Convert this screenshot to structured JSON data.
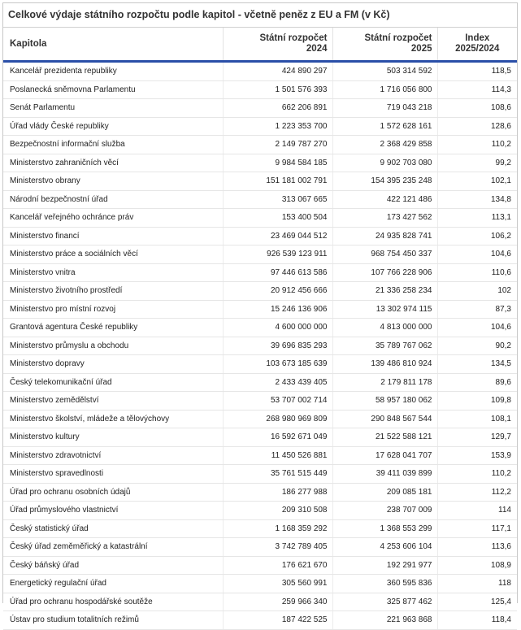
{
  "title": "Celkové výdaje státního rozpočtu podle kapitol - včetně peněz z EU a FM (v Kč)",
  "columns": {
    "kapitola": "Kapitola",
    "rozpocet_2024": [
      "Státní rozpočet",
      "2024"
    ],
    "rozpocet_2025": [
      "Státní rozpočet",
      "2025"
    ],
    "index": [
      "Index",
      "2025/2024"
    ]
  },
  "rows": [
    {
      "name": "Kancelář prezidenta republiky",
      "r2024": "424 890 297",
      "r2025": "503 314 592",
      "index": "118,5"
    },
    {
      "name": "Poslanecká sněmovna Parlamentu",
      "r2024": "1 501 576 393",
      "r2025": "1 716 056 800",
      "index": "114,3"
    },
    {
      "name": "Senát Parlamentu",
      "r2024": "662 206 891",
      "r2025": "719 043 218",
      "index": "108,6"
    },
    {
      "name": "Úřad vlády České republiky",
      "r2024": "1 223 353 700",
      "r2025": "1 572 628 161",
      "index": "128,6"
    },
    {
      "name": "Bezpečnostní informační služba",
      "r2024": "2 149 787 270",
      "r2025": "2 368 429 858",
      "index": "110,2"
    },
    {
      "name": "Ministerstvo zahraničních věcí",
      "r2024": "9 984 584 185",
      "r2025": "9 902 703 080",
      "index": "99,2"
    },
    {
      "name": "Ministerstvo obrany",
      "r2024": "151 181 002 791",
      "r2025": "154 395 235 248",
      "index": "102,1"
    },
    {
      "name": "Národní bezpečnostní úřad",
      "r2024": "313 067 665",
      "r2025": "422 121 486",
      "index": "134,8"
    },
    {
      "name": "Kancelář veřejného ochránce práv",
      "r2024": "153 400 504",
      "r2025": "173 427 562",
      "index": "113,1"
    },
    {
      "name": "Ministerstvo financí",
      "r2024": "23 469 044 512",
      "r2025": "24 935 828 741",
      "index": "106,2"
    },
    {
      "name": "Ministerstvo práce a sociálních věcí",
      "r2024": "926 539 123 911",
      "r2025": "968 754 450 337",
      "index": "104,6"
    },
    {
      "name": "Ministerstvo vnitra",
      "r2024": "97 446 613 586",
      "r2025": "107 766 228 906",
      "index": "110,6"
    },
    {
      "name": "Ministerstvo životního prostředí",
      "r2024": "20 912 456 666",
      "r2025": "21 336 258 234",
      "index": "102"
    },
    {
      "name": "Ministerstvo pro místní rozvoj",
      "r2024": "15 246 136 906",
      "r2025": "13 302 974 115",
      "index": "87,3"
    },
    {
      "name": "Grantová agentura České republiky",
      "r2024": "4 600 000 000",
      "r2025": "4 813 000 000",
      "index": "104,6"
    },
    {
      "name": "Ministerstvo průmyslu a obchodu",
      "r2024": "39 696 835 293",
      "r2025": "35 789 767 062",
      "index": "90,2"
    },
    {
      "name": "Ministerstvo dopravy",
      "r2024": "103 673 185 639",
      "r2025": "139 486 810 924",
      "index": "134,5"
    },
    {
      "name": "Český telekomunikační úřad",
      "r2024": "2 433 439 405",
      "r2025": "2 179 811 178",
      "index": "89,6"
    },
    {
      "name": "Ministerstvo zemědělství",
      "r2024": "53 707 002 714",
      "r2025": "58 957 180 062",
      "index": "109,8"
    },
    {
      "name": "Ministerstvo školství, mládeže a tělovýchovy",
      "r2024": "268 980 969 809",
      "r2025": "290 848 567 544",
      "index": "108,1"
    },
    {
      "name": "Ministerstvo kultury",
      "r2024": "16 592 671 049",
      "r2025": "21 522 588 121",
      "index": "129,7"
    },
    {
      "name": "Ministerstvo zdravotnictví",
      "r2024": "11 450 526 881",
      "r2025": "17 628 041 707",
      "index": "153,9"
    },
    {
      "name": "Ministerstvo spravedlnosti",
      "r2024": "35 761 515 449",
      "r2025": "39 411 039 899",
      "index": "110,2"
    },
    {
      "name": "Úřad pro ochranu osobních údajů",
      "r2024": "186 277 988",
      "r2025": "209 085 181",
      "index": "112,2"
    },
    {
      "name": "Úřad průmyslového vlastnictví",
      "r2024": "209 310 508",
      "r2025": "238 707 009",
      "index": "114"
    },
    {
      "name": "Český statistický úřad",
      "r2024": "1 168 359 292",
      "r2025": "1 368 553 299",
      "index": "117,1"
    },
    {
      "name": "Český úřad zeměměřický a katastrální",
      "r2024": "3 742 789 405",
      "r2025": "4 253 606 104",
      "index": "113,6"
    },
    {
      "name": "Český báňský úřad",
      "r2024": "176 621 670",
      "r2025": "192 291 977",
      "index": "108,9"
    },
    {
      "name": "Energetický regulační úřad",
      "r2024": "305 560 991",
      "r2025": "360 595 836",
      "index": "118"
    },
    {
      "name": "Úřad pro ochranu hospodářské soutěže",
      "r2024": "259 966 340",
      "r2025": "325 877 462",
      "index": "125,4"
    },
    {
      "name": "Ústav pro studium totalitních režimů",
      "r2024": "187 422 525",
      "r2025": "221 963 868",
      "index": "118,4"
    }
  ]
}
